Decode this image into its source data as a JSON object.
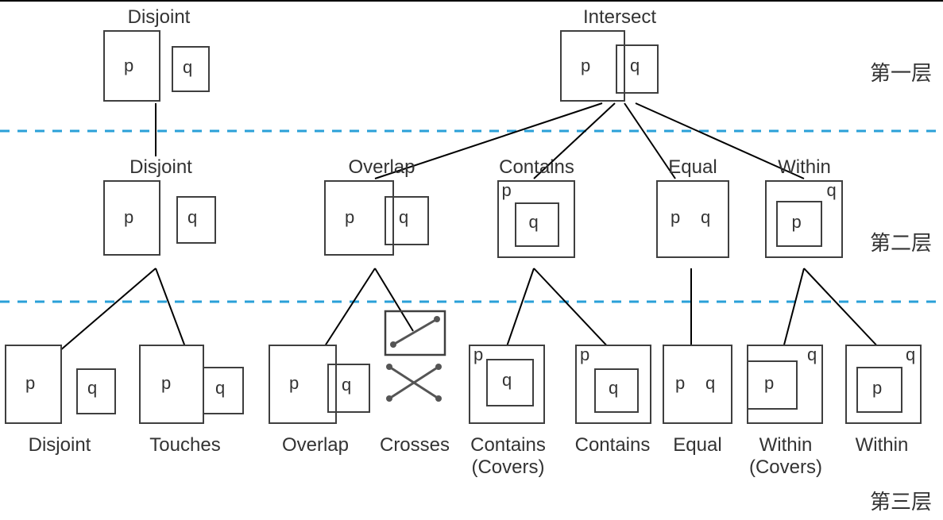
{
  "p_label": "p",
  "q_label": "q",
  "layers": {
    "l1": "第一层",
    "l2": "第二层",
    "l3": "第三层"
  },
  "nodes": {
    "l1_disjoint": "Disjoint",
    "l1_intersect": "Intersect",
    "l2_disjoint": "Disjoint",
    "l2_overlap": "Overlap",
    "l2_contains": "Contains",
    "l2_equal": "Equal",
    "l2_within": "Within",
    "l3_disjoint": "Disjoint",
    "l3_touches": "Touches",
    "l3_overlap": "Overlap",
    "l3_crosses": "Crosses",
    "l3_contains_covers": "Contains\n(Covers)",
    "l3_contains": "Contains",
    "l3_equal": "Equal",
    "l3_within_covers": "Within\n(Covers)",
    "l3_within": "Within"
  }
}
